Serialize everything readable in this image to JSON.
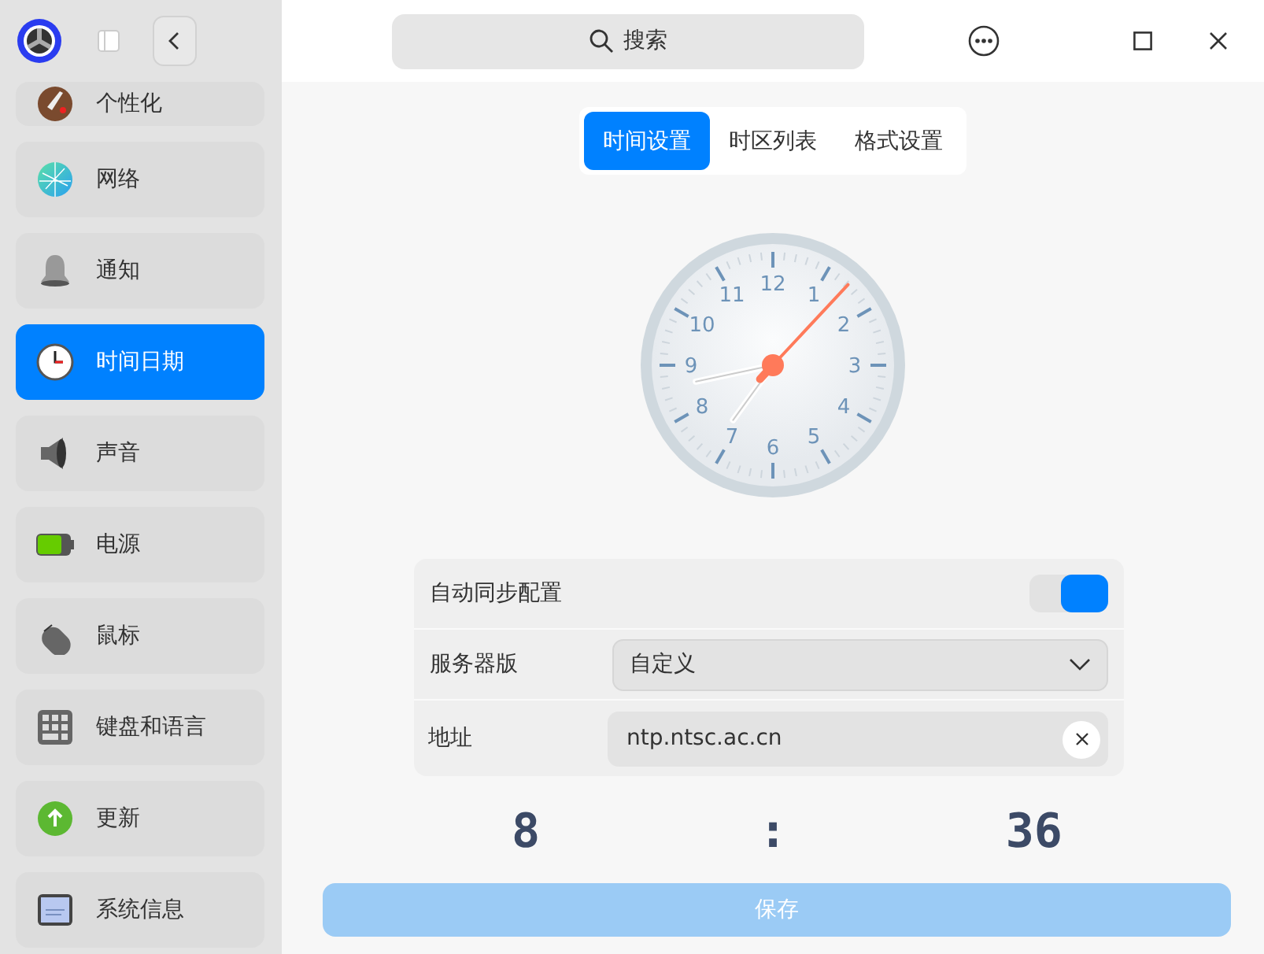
{
  "sidebar": {
    "items": [
      {
        "label": "个性化",
        "selected": false
      },
      {
        "label": "网络",
        "selected": false
      },
      {
        "label": "通知",
        "selected": false
      },
      {
        "label": "时间日期",
        "selected": true
      },
      {
        "label": "声音",
        "selected": false
      },
      {
        "label": "电源",
        "selected": false
      },
      {
        "label": "鼠标",
        "selected": false
      },
      {
        "label": "键盘和语言",
        "selected": false
      },
      {
        "label": "更新",
        "selected": false
      },
      {
        "label": "系统信息",
        "selected": false
      }
    ]
  },
  "search": {
    "placeholder": "搜索"
  },
  "tabs": [
    {
      "label": "时间设置",
      "selected": true
    },
    {
      "label": "时区列表",
      "selected": false
    },
    {
      "label": "格式设置",
      "selected": false
    }
  ],
  "clock": {
    "dial_numbers": [
      "12",
      "1",
      "2",
      "3",
      "4",
      "5",
      "6",
      "7",
      "8",
      "9",
      "10",
      "11"
    ]
  },
  "settings": {
    "auto_sync": {
      "label": "自动同步配置",
      "on": true
    },
    "server": {
      "label": "服务器版",
      "value": "自定义"
    },
    "address": {
      "label": "地址",
      "value": "ntp.ntsc.ac.cn"
    }
  },
  "time": {
    "hours": "8",
    "separator": ":",
    "minutes": "36"
  },
  "save_button": {
    "label": "保存",
    "disabled": true
  }
}
